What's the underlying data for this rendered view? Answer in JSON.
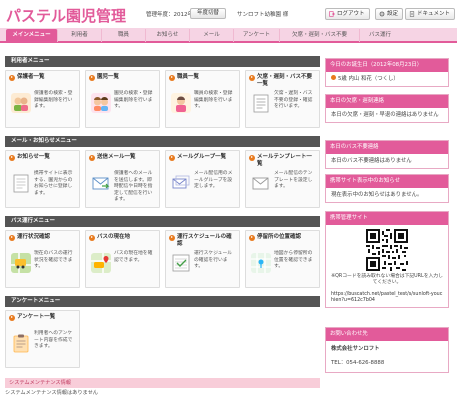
{
  "header": {
    "logo": "パステル園児管理",
    "meta": "管理年度：2012年度",
    "year_button": "年度切替",
    "user": "サンロフト幼稚園 様",
    "logout": "ログアウト",
    "settings": "設定",
    "documents": "ドキュメント"
  },
  "nav": {
    "tabs": [
      {
        "label": "メインメニュー"
      },
      {
        "label": "利用者"
      },
      {
        "label": "職員"
      },
      {
        "label": "お知らせ"
      },
      {
        "label": "メール"
      },
      {
        "label": "アンケート"
      },
      {
        "label": "欠席・遅刻・バス不要"
      },
      {
        "label": "バス運行"
      }
    ]
  },
  "sections": {
    "users": {
      "title": "利用者メニュー",
      "cards": [
        {
          "title": "保護者一覧",
          "desc": "保護者の検索・登録編集削除を行います。",
          "icon": "parents-icon"
        },
        {
          "title": "園児一覧",
          "desc": "園児の検索・登録編集削除を行います。",
          "icon": "children-icon"
        },
        {
          "title": "職員一覧",
          "desc": "職員の検索・登録編集削除を行います。",
          "icon": "staff-icon"
        },
        {
          "title": "欠席・遅刻・バス不要一覧",
          "desc": "欠席・遅刻・バス不要の登録・確認を行います。",
          "icon": "document-icon"
        }
      ]
    },
    "mail": {
      "title": "メール・お知らせメニュー",
      "cards": [
        {
          "title": "お知らせ一覧",
          "desc": "携帯サイトに表示する、園児からのお知らせに登録します。",
          "icon": "notice-icon"
        },
        {
          "title": "送信メール一覧",
          "desc": "保護者へのメールを送信します。即時配信や日時を指定して配信を行います。",
          "icon": "send-mail-icon"
        },
        {
          "title": "メールグループ一覧",
          "desc": "メール配信用のメールグループを設定します。",
          "icon": "mail-group-icon"
        },
        {
          "title": "メールテンプレート一覧",
          "desc": "メール配信のテンプレートを設定します。",
          "icon": "template-icon"
        }
      ]
    },
    "bus": {
      "title": "バス運行メニュー",
      "cards": [
        {
          "title": "運行状況確認",
          "desc": "現在のバスの運行状況を確認できます。",
          "icon": "bus-status-icon"
        },
        {
          "title": "バスの現在地",
          "desc": "バスの現在地を確認できます。",
          "icon": "bus-location-icon"
        },
        {
          "title": "運行スケジュールの確認",
          "desc": "運行スケジュールの確認を行います。",
          "icon": "schedule-icon"
        },
        {
          "title": "停留所の位置確認",
          "desc": "地図から停留所の位置を確認できます。",
          "icon": "map-icon"
        }
      ]
    },
    "survey": {
      "title": "アンケートメニュー",
      "cards": [
        {
          "title": "アンケート一覧",
          "desc": "利用者へのアンケート内容を作成できます。",
          "icon": "survey-icon"
        }
      ]
    }
  },
  "maintenance": {
    "title": "システムメンテナンス情報",
    "body": "システムメンテナンス情報はありません"
  },
  "side": {
    "birthday": {
      "title": "今日のお誕生日（2012年08月23日）",
      "body": "5歳 内山 和花（つくし）"
    },
    "absence": {
      "title": "本日の欠席・遅刻連絡",
      "body": "本日の欠席・遅刻・早退の連絡はありません"
    },
    "bus_none": {
      "title": "本日のバス不要連絡",
      "body": "本日のバス不要連絡はありません"
    },
    "notice": {
      "title": "携帯サイト表示中のお知らせ",
      "body": "現在表示中のお知らせはありません。"
    },
    "mobile": {
      "title": "携帯管理サイト",
      "note": "※QRコードを読み取れない場合は下記URLを入力してください。",
      "url": "https://buscatch.net/pastel_test/s/sunloft-youchien?u=612c7b04"
    },
    "contact": {
      "title": "お問い合わせ先",
      "company": "株式会社サンロフト",
      "tel": "TEL：054-626-8888"
    }
  },
  "colors": {
    "accent": "#e25b9a",
    "section_head": "#555555",
    "arrow": "#e87a1e"
  }
}
